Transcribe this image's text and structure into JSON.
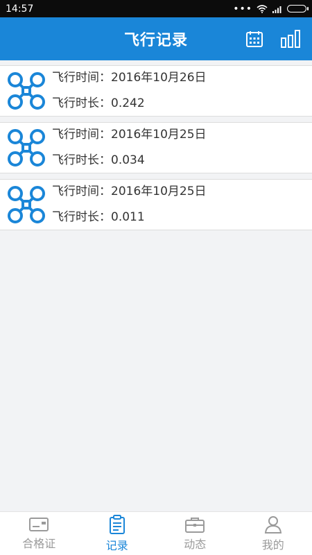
{
  "status_bar": {
    "time": "14:57",
    "icons": [
      "signal-dots-icon",
      "wifi-icon",
      "cellular-icon",
      "battery-icon"
    ],
    "dots": "•••"
  },
  "app_bar": {
    "title": "飞行记录",
    "actions": [
      {
        "name": "calendar-icon"
      },
      {
        "name": "bar-chart-icon"
      }
    ]
  },
  "records": [
    {
      "time_label": "飞行时间：",
      "time_value": "2016年10月26日",
      "duration_label": "飞行时长：",
      "duration_value": "0.242"
    },
    {
      "time_label": "飞行时间：",
      "time_value": "2016年10月25日",
      "duration_label": "飞行时长：",
      "duration_value": "0.034"
    },
    {
      "time_label": "飞行时间：",
      "time_value": "2016年10月25日",
      "duration_label": "飞行时长：",
      "duration_value": "0.011"
    }
  ],
  "bottom_nav": {
    "items": [
      {
        "label": "合格证",
        "icon": "certificate-icon",
        "active": false
      },
      {
        "label": "记录",
        "icon": "clipboard-icon",
        "active": true
      },
      {
        "label": "动态",
        "icon": "briefcase-icon",
        "active": false
      },
      {
        "label": "我的",
        "icon": "user-icon",
        "active": false
      }
    ]
  },
  "colors": {
    "accent": "#1a86d8",
    "background": "#f2f3f5",
    "inactive": "#9a9a9a"
  }
}
